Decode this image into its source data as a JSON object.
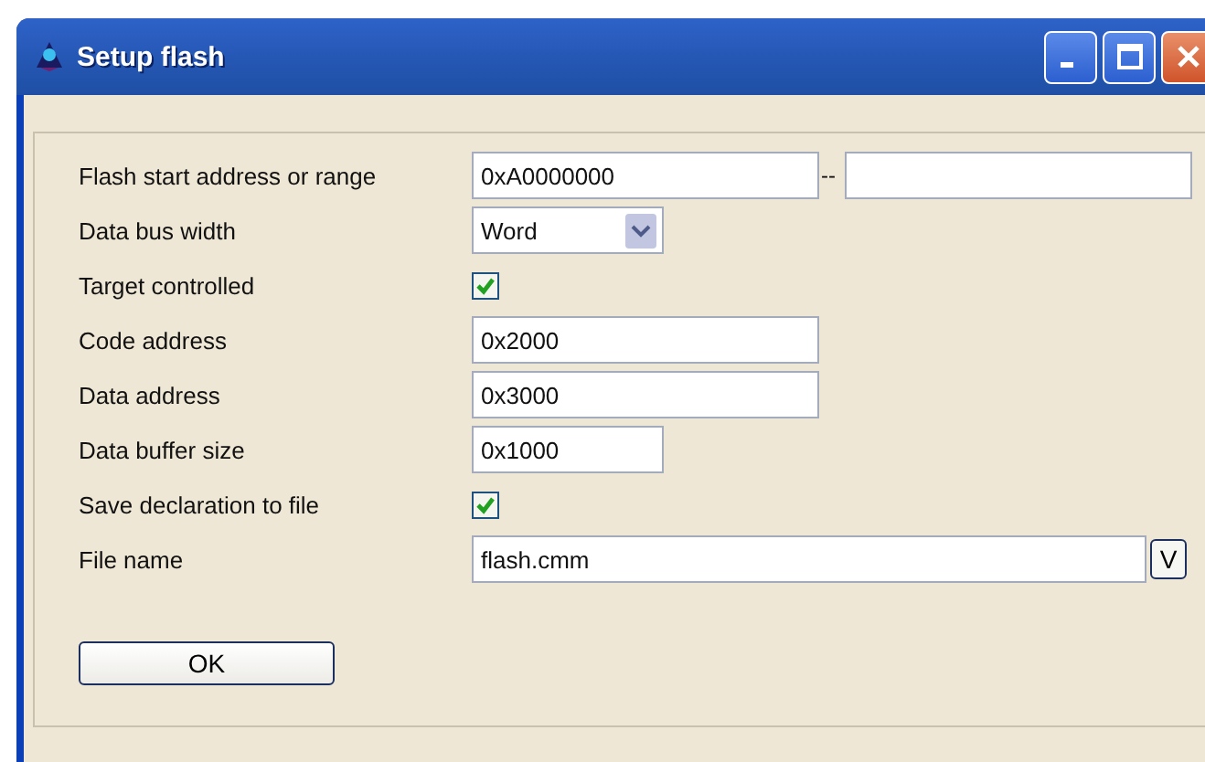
{
  "window": {
    "title": "Setup flash"
  },
  "fields": [
    {
      "kind": "range",
      "label": "Flash start address or range",
      "value": "0xA0000000",
      "separator": "--"
    },
    {
      "kind": "select",
      "label": "Data bus width",
      "value": "Word"
    },
    {
      "kind": "checkbox",
      "label": "Target controlled",
      "checked": true
    },
    {
      "kind": "text",
      "label": "Code address",
      "value": "0x2000"
    },
    {
      "kind": "text",
      "label": "Data address",
      "value": "0x3000"
    },
    {
      "kind": "short",
      "label": "Data buffer size",
      "value": "0x1000"
    },
    {
      "kind": "checkbox",
      "label": "Save declaration to file",
      "checked": true
    },
    {
      "kind": "file",
      "label": "File name",
      "value": "flash.cmm",
      "browse": "V"
    }
  ],
  "buttons": [
    "OK"
  ]
}
